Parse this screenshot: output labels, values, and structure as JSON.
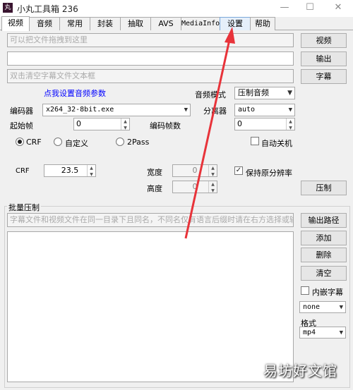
{
  "window": {
    "title": "小丸工具箱 236",
    "icon_text": "丸"
  },
  "tabs": [
    {
      "label": "视频"
    },
    {
      "label": "音频"
    },
    {
      "label": "常用"
    },
    {
      "label": "封装"
    },
    {
      "label": "抽取"
    },
    {
      "label": "AVS"
    },
    {
      "label": "MediaInfo"
    },
    {
      "label": "设置"
    },
    {
      "label": "帮助"
    }
  ],
  "video_tab": {
    "video_input_placeholder": "可以把文件拖拽到这里",
    "video_button": "视频",
    "output_input_value": "",
    "output_button": "输出",
    "subtitle_input_placeholder": "双击清空字幕文件文本框",
    "subtitle_button": "字幕",
    "audio_settings_link": "点我设置音频参数",
    "audio_mode_label": "音频模式",
    "audio_mode_value": "压制音频",
    "encoder_label": "编码器",
    "encoder_value": "x264_32-8bit.exe",
    "splitter_label": "分离器",
    "splitter_value": "auto",
    "start_frame_label": "起始帧",
    "start_frame_value": "0",
    "encode_frames_label": "编码帧数",
    "encode_frames_value": "0",
    "radio_crf": "CRF",
    "radio_custom": "自定义",
    "radio_2pass": "2Pass",
    "radio_selected": "CRF",
    "auto_shutdown_label": "自动关机",
    "auto_shutdown_checked": false,
    "crf_label": "CRF",
    "crf_value": "23.5",
    "width_label": "宽度",
    "width_value": "0",
    "height_label": "高度",
    "height_value": "0",
    "keep_resolution_label": "保持原分辨率",
    "keep_resolution_checked": true,
    "encode_button": "压制"
  },
  "batch": {
    "title": "批量压制",
    "hint_placeholder": "字幕文件和视频文件在同一目录下且同名，不同名仅有语言后缀时请在右方选择或输入",
    "output_path_button": "输出路径",
    "add_button": "添加",
    "delete_button": "删除",
    "clear_button": "清空",
    "embed_subtitle_label": "内嵌字幕",
    "embed_subtitle_checked": false,
    "subtitle_select_value": "none",
    "format_label": "格式",
    "format_value": "mp4"
  },
  "watermark": "易坊好文馆",
  "colors": {
    "link_blue": "#0000ff",
    "arrow_red": "#e8333a",
    "selected_tab_bg": "#ffffff",
    "highlight_tab_bg": "#e5effa"
  },
  "icons": {
    "check": "✓",
    "dropdown": "▼",
    "spin_up": "▲",
    "spin_down": "▼"
  }
}
